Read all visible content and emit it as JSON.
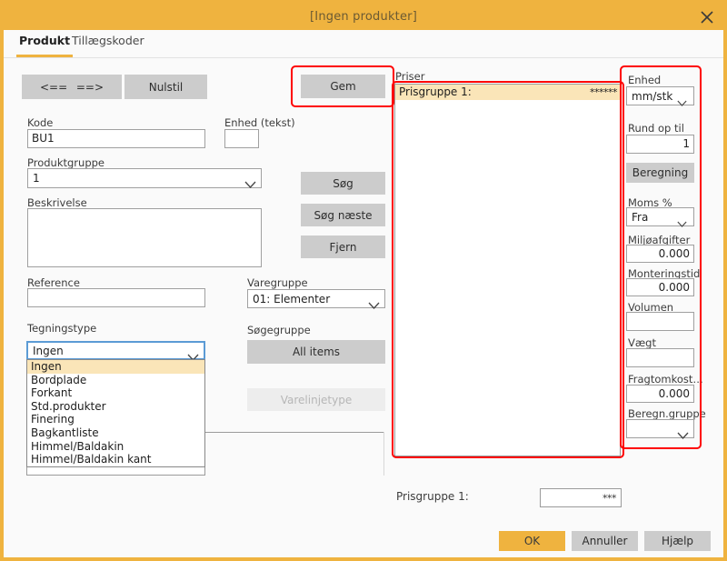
{
  "window": {
    "title": "[Ingen produkter]",
    "close_icon": "close-icon",
    "border_color": "#efb33f",
    "titlebar_color": "#efb33f"
  },
  "tabs": [
    {
      "label": "Produkt",
      "active": true
    },
    {
      "label": "Tillægskoder",
      "active": false
    }
  ],
  "toolbar": {
    "prev_label": "<==",
    "next_label": "==>",
    "reset_label": "Nulstil",
    "save_label": "Gem"
  },
  "left_form": {
    "kode_label": "Kode",
    "kode_value": "BU1",
    "enhed_tekst_label": "Enhed (tekst)",
    "enhed_tekst_value": "",
    "produktgruppe_label": "Produktgruppe",
    "produktgruppe_value": "1",
    "beskrivelse_label": "Beskrivelse",
    "beskrivelse_value": "",
    "reference_label": "Reference",
    "reference_value": "",
    "tegningstype_label": "Tegningstype",
    "tegningstype_value": "Ingen",
    "tegningstype_options": [
      "Ingen",
      "Bordplade",
      "Forkant",
      "Std.produkter",
      "Finering",
      "Bagkantliste",
      "Himmel/Baldakin",
      "Himmel/Baldakin kant"
    ],
    "tegningstype_selected_index": 0
  },
  "mid_column": {
    "soeg_label": "Søg",
    "soeg_naeste_label": "Søg næste",
    "fjern_label": "Fjern",
    "varegruppe_label": "Varegruppe",
    "varegruppe_value": "01: Elementer",
    "soegegruppe_label": "Søgegruppe",
    "all_items_label": "All items",
    "varelinjetype_label": "Varelinjetype",
    "varelinjetype_disabled": true
  },
  "priser": {
    "header_label": "Priser",
    "rows": [
      {
        "name": "Prisgruppe  1:",
        "value": "******",
        "selected": true
      }
    ]
  },
  "enhed_panel": {
    "enhed_label": "Enhed",
    "enhed_value": "mm/stk",
    "rund_op_til_label": "Rund op til",
    "rund_op_til_value": "1",
    "beregning_label": "Beregning",
    "moms_label": "Moms %",
    "moms_value": "Fra",
    "miljoeafgifter_label": "Miljøafgifter",
    "miljoeafgifter_value": "0.000",
    "monteringstid_label": "Monteringstid",
    "monteringstid_value": "0.000",
    "volumen_label": "Volumen",
    "volumen_value": "",
    "vaegt_label": "Vægt",
    "vaegt_value": "",
    "fragtomkost_label": "Fragtomkost…",
    "fragtomkost_value": "0.000",
    "beregn_gruppe_label": "Beregn.gruppe",
    "beregn_gruppe_value": ""
  },
  "bottom": {
    "prisgruppe_label": "Prisgruppe  1:",
    "prisgruppe_value": "***",
    "ok_label": "OK",
    "cancel_label": "Annuller",
    "help_label": "Hjælp"
  },
  "annotations": {
    "accent_red": "#fe0000",
    "highlight_row": "#fae5b8",
    "boxes": [
      "gem-button-highlight",
      "priser-panel-highlight",
      "enhed-panel-highlight"
    ]
  }
}
